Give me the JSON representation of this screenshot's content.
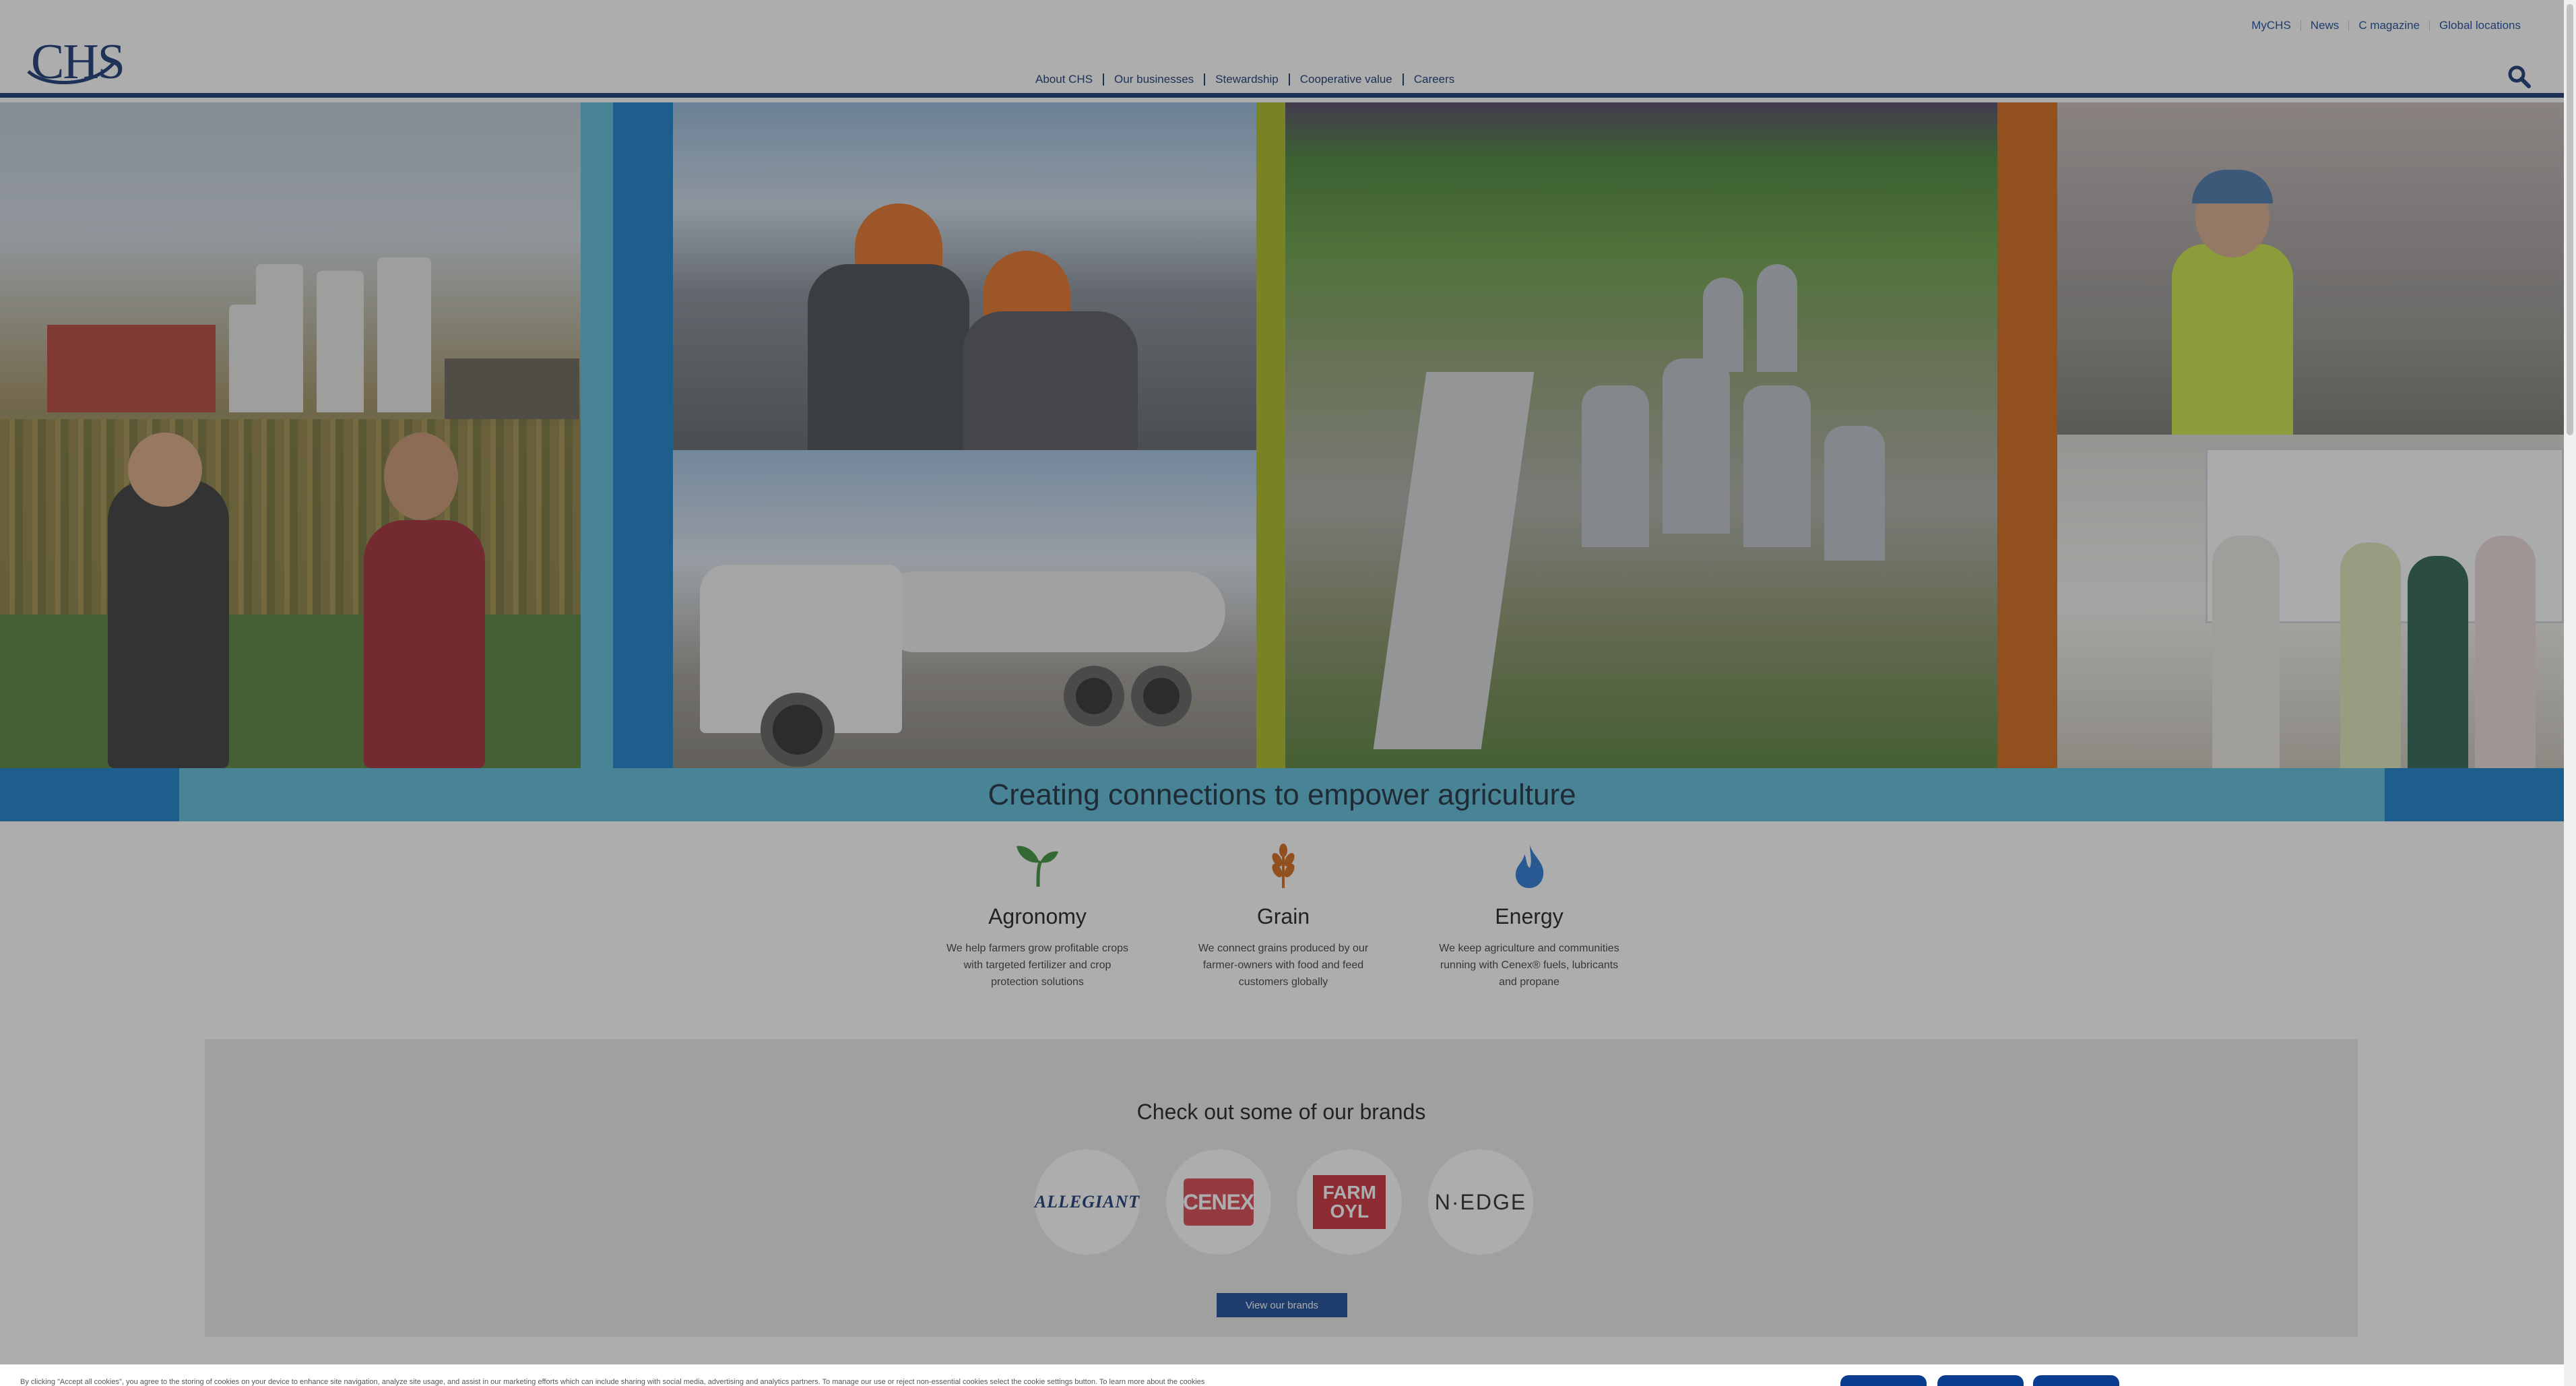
{
  "header": {
    "utility_nav": [
      "MyCHS",
      "News",
      "C magazine",
      "Global locations"
    ],
    "main_nav": [
      "About CHS",
      "Our businesses",
      "Stewardship",
      "Cooperative value",
      "Careers"
    ],
    "logo_text": "CHS",
    "search_icon": "search-icon"
  },
  "hero": {
    "strip_colors": [
      "#52b8d6",
      "#0a77c9",
      "#a5b614",
      "#d35f0c"
    ]
  },
  "tagline": "Creating connections to empower agriculture",
  "areas": [
    {
      "icon": "sprout-icon",
      "color": "#2f8a2f",
      "title": "Agronomy",
      "desc": "We help farmers grow profitable crops with targeted fertilizer and crop protection solutions"
    },
    {
      "icon": "wheat-icon",
      "color": "#d35f0c",
      "title": "Grain",
      "desc": "We connect grains produced by our farmer-owners with food and feed customers globally"
    },
    {
      "icon": "flame-icon",
      "color": "#1a6fd0",
      "title": "Energy",
      "desc": "We keep agriculture and communities running with Cenex® fuels, lubricants and propane"
    }
  ],
  "brands": {
    "title": "Check out some of our brands",
    "items": [
      {
        "name": "allegiant-logo",
        "text": "ALLEGIANT"
      },
      {
        "name": "cenex-logo",
        "text": "CENEX"
      },
      {
        "name": "farmoyl-logo",
        "text": "FARM OYL"
      },
      {
        "name": "nedge-logo",
        "text": "N·EDGE"
      }
    ],
    "button_label": "View our brands"
  },
  "cookie": {
    "text": "By clicking \"Accept all cookies\", you agree to the storing of cookies on your device to enhance site navigation, analyze site usage, and assist in our marketing efforts which can include sharing with social media, advertising and analytics partners. To manage our use or reject non-essential cookies select the cookie settings button. To learn more about the cookies"
  }
}
